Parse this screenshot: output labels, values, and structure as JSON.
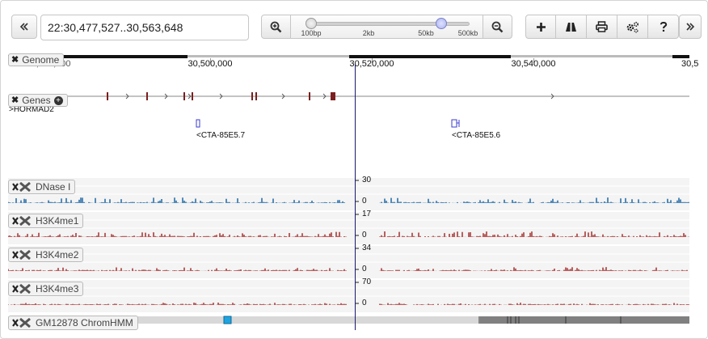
{
  "location": {
    "value": "22:30,477,527..30,563,648"
  },
  "zoom": {
    "labels": [
      "100bp",
      "2kb",
      "50kb",
      "500kb"
    ],
    "level_fraction": 0.82
  },
  "ruler": {
    "labels": [
      "30,480,000",
      "30,500,000",
      "30,520,000",
      "30,540,000",
      "30,5"
    ]
  },
  "tracks": {
    "genome": {
      "label": "Genome"
    },
    "genes": {
      "label": "Genes",
      "gene_name": ">HORMAD2",
      "transcripts": [
        "<CTA-85E5.7",
        "<CTA-85E5.6"
      ]
    },
    "dnase": {
      "label": "DNase I",
      "scale_max": "30",
      "scale_min": "0",
      "color": "#2a6fa8"
    },
    "h3k4me1": {
      "label": "H3K4me1",
      "scale_max": "17",
      "scale_min": "0",
      "color": "#a83a3a"
    },
    "h3k4me2": {
      "label": "H3K4me2",
      "scale_max": "34",
      "scale_min": "0",
      "color": "#a83a3a"
    },
    "h3k4me3": {
      "label": "H3K4me3",
      "scale_max": "70",
      "scale_min": "0",
      "color": "#a83a3a"
    },
    "chromhmm": {
      "label": "GM12878 ChromHMM"
    }
  },
  "colors": {
    "gene": "#7a1f1f",
    "transcript": "#3b3bd0",
    "cursor": "#1a1a6e",
    "chromhmm_active": "#1ea3e0",
    "chromhmm_repressed": "#808080"
  },
  "icons": {
    "back": "double-chevron-left-icon",
    "zoom_in": "zoom-in-icon",
    "zoom_out": "zoom-out-icon",
    "add": "plus-icon",
    "highlight": "road-icon",
    "print": "print-icon",
    "settings": "gears-icon",
    "help": "question-icon",
    "forward": "double-chevron-right-icon"
  }
}
